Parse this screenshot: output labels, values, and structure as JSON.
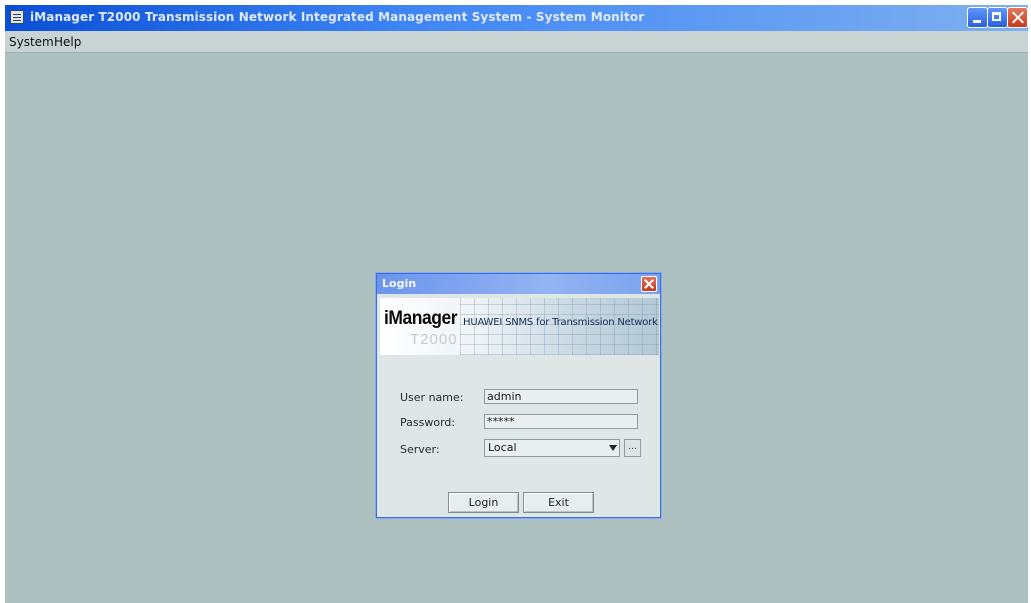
{
  "window": {
    "title": "iManager T2000 Transmission Network Integrated Management System - System Monitor"
  },
  "menubar": {
    "items": [
      "System",
      "Help"
    ]
  },
  "login_dialog": {
    "title": "Login",
    "banner": {
      "brand": "iManager",
      "tagline": "HUAWEI SNMS for Transmission Network",
      "product": "T2000"
    },
    "fields": {
      "username_label": "User name:",
      "username_value": "admin",
      "password_label": "Password:",
      "password_value": "*****",
      "server_label": "Server:",
      "server_value": "Local",
      "browse_label": "..."
    },
    "buttons": {
      "login": "Login",
      "exit": "Exit"
    }
  },
  "colors": {
    "desktop_background": "#aec1c1",
    "titlebar": "#0a4fd6",
    "dialog_title": "#7aa2ef"
  },
  "icons": [
    "app-window-icon",
    "minimize-icon",
    "maximize-icon",
    "close-icon",
    "dropdown-arrow-icon"
  ]
}
